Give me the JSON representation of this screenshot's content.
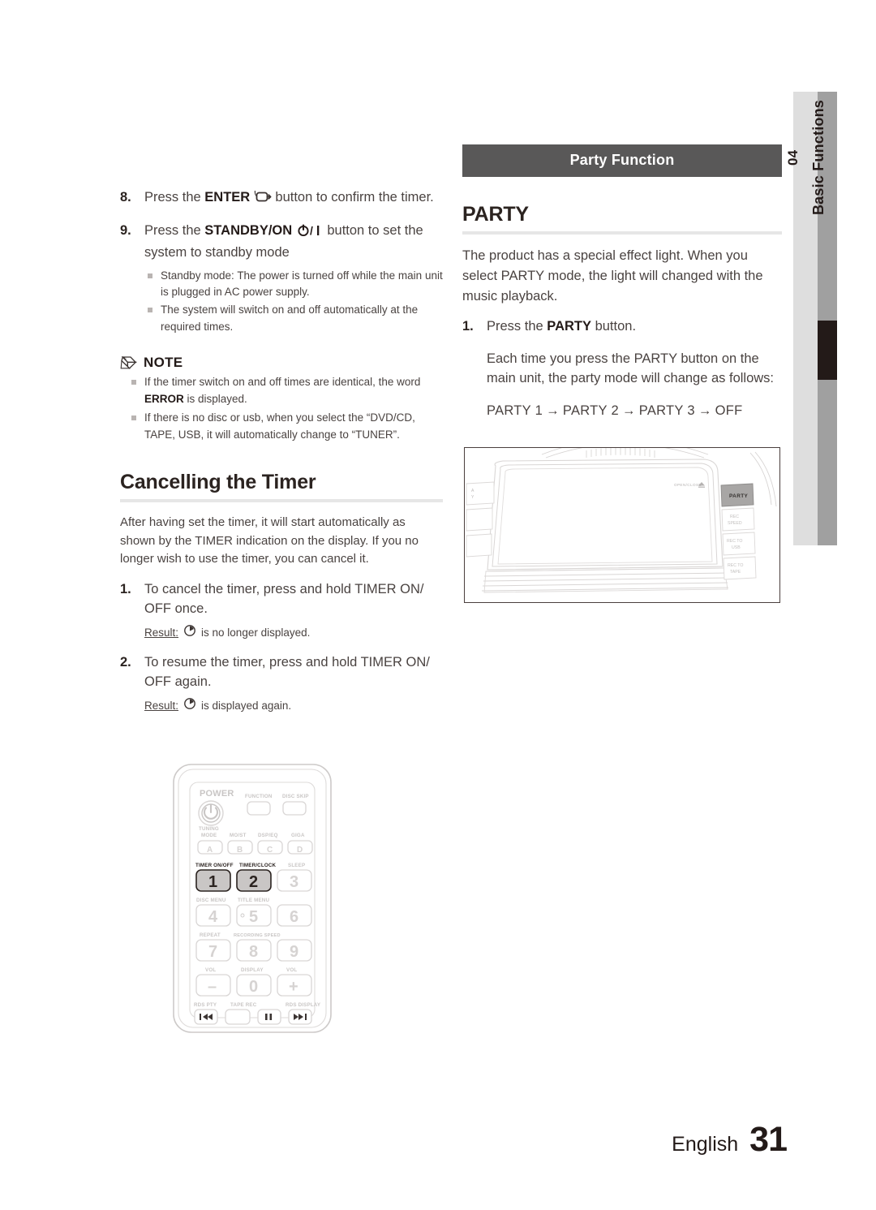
{
  "chapter_tab": {
    "number": "04",
    "name": "Basic Functions"
  },
  "left_column": {
    "steps": [
      {
        "num": "8.",
        "text_before": "Press the ",
        "bold": "ENTER",
        "icon": "enter-key-icon",
        "text_after": " button to confirm the timer."
      },
      {
        "num": "9.",
        "text_before": "Press the ",
        "bold": "STANDBY/ON",
        "icon": "power-standby-icon",
        "text_after": " button to set the system to standby mode",
        "sub_items": [
          "Standby mode: The power is turned off while the main unit is plugged in AC power supply.",
          "The system will switch on and off automatically at the required times."
        ]
      }
    ],
    "note": {
      "icon": "pencil-note-icon",
      "title": "NOTE",
      "items": [
        {
          "prefix": "If the timer switch on and off times are identical, the word ",
          "bold": "ERROR",
          "suffix": " is displayed."
        },
        {
          "prefix": "If there is no disc or usb, when you select the “DVD/CD, TAPE, USB, it will automatically change to “TUNER”.",
          "bold": "",
          "suffix": ""
        }
      ]
    },
    "section": {
      "heading": "Cancelling the Timer",
      "intro": "After having set the timer, it will start automatically as shown by the TIMER indication on the display. If you no longer wish to use the timer, you can cancel it.",
      "steps": [
        {
          "num": "1.",
          "text": "To cancel the timer, press and hold TIMER ON/ OFF once.",
          "result_label": "Result:",
          "result_icon": "timer-clock-icon",
          "result_text": "is no longer displayed."
        },
        {
          "num": "2.",
          "text": "To resume the timer, press and hold TIMER ON/ OFF again.",
          "result_label": "Result:",
          "result_icon": "timer-clock-icon",
          "result_text": "is displayed again."
        }
      ]
    }
  },
  "right_column": {
    "band_title": "Party Function",
    "heading": "PARTY",
    "intro": "The product has a special effect light. When you select PARTY mode, the light will changed with the music playback.",
    "steps": [
      {
        "num": "1.",
        "text_before": "Press the ",
        "bold": "PARTY",
        "text_after": " button."
      }
    ],
    "explanation": "Each time you press the PARTY button on the main unit, the party mode will change as follows:",
    "flow": {
      "items": [
        "PARTY 1",
        "PARTY 2",
        "PARTY 3",
        "OFF"
      ],
      "arrow": "→"
    }
  },
  "figure_unit": {
    "name": "main-unit-front-panel",
    "open_close_label": "OPEN/CLOSE",
    "open_close_icon": "eject-icon",
    "left_labels": [
      "A",
      "Y"
    ],
    "buttons": [
      {
        "label": "PARTY",
        "highlighted": true
      },
      {
        "label": "REC\nSPEED",
        "highlighted": false
      },
      {
        "label": "REC TO\nUSB",
        "highlighted": false
      },
      {
        "label": "REC TO\nTAPE",
        "highlighted": false
      }
    ]
  },
  "figure_remote": {
    "name": "remote-control",
    "power_label": "POWER",
    "power_icon": "power-icon",
    "top_buttons": [
      {
        "label": "FUNCTION"
      },
      {
        "label": "DISC SKIP"
      }
    ],
    "letter_row": [
      {
        "label": "TUNING\nMODE",
        "key": "A"
      },
      {
        "label": "MO/ST",
        "key": "B"
      },
      {
        "label": "DSP/EQ",
        "key": "C"
      },
      {
        "label": "GIGA",
        "key": "D"
      }
    ],
    "keypad": [
      {
        "label": "TIMER ON/OFF",
        "key": "1",
        "highlighted": true
      },
      {
        "label": "TIMER/CLOCK",
        "key": "2",
        "highlighted": true
      },
      {
        "label": "SLEEP",
        "key": "3",
        "highlighted": false
      },
      {
        "label": "DISC MENU",
        "key": "4",
        "highlighted": false
      },
      {
        "label": "TITLE MENU",
        "key": "5",
        "highlighted": false
      },
      {
        "label": "",
        "key": "6",
        "highlighted": false
      },
      {
        "label": "REPEAT",
        "key": "7",
        "highlighted": false
      },
      {
        "label": "RECORDING SPEED",
        "key": "8",
        "highlighted": false
      },
      {
        "label": "",
        "key": "9",
        "highlighted": false
      },
      {
        "label": "VOL",
        "key": "–",
        "highlighted": false
      },
      {
        "label": "DISPLAY",
        "key": "0",
        "highlighted": false
      },
      {
        "label": "VOL",
        "key": "+",
        "highlighted": false
      }
    ],
    "bottom_row": [
      {
        "label": "RDS PTY",
        "icon": "skip-back-icon"
      },
      {
        "label": "TAPE REC",
        "icon": "blank-icon"
      },
      {
        "label": "",
        "icon": "pause-icon"
      },
      {
        "label": "RDS DISPLAY",
        "icon": "skip-forward-icon"
      }
    ]
  },
  "footer": {
    "language": "English",
    "page_number": "31"
  },
  "colors": {
    "band_bg": "#595858",
    "tab_light": "#dedede",
    "tab_mid": "#a0a0a0",
    "tab_marker": "#231a18",
    "rule": "#e6e6e6",
    "text": "#4a4341",
    "heading": "#2b2320"
  }
}
